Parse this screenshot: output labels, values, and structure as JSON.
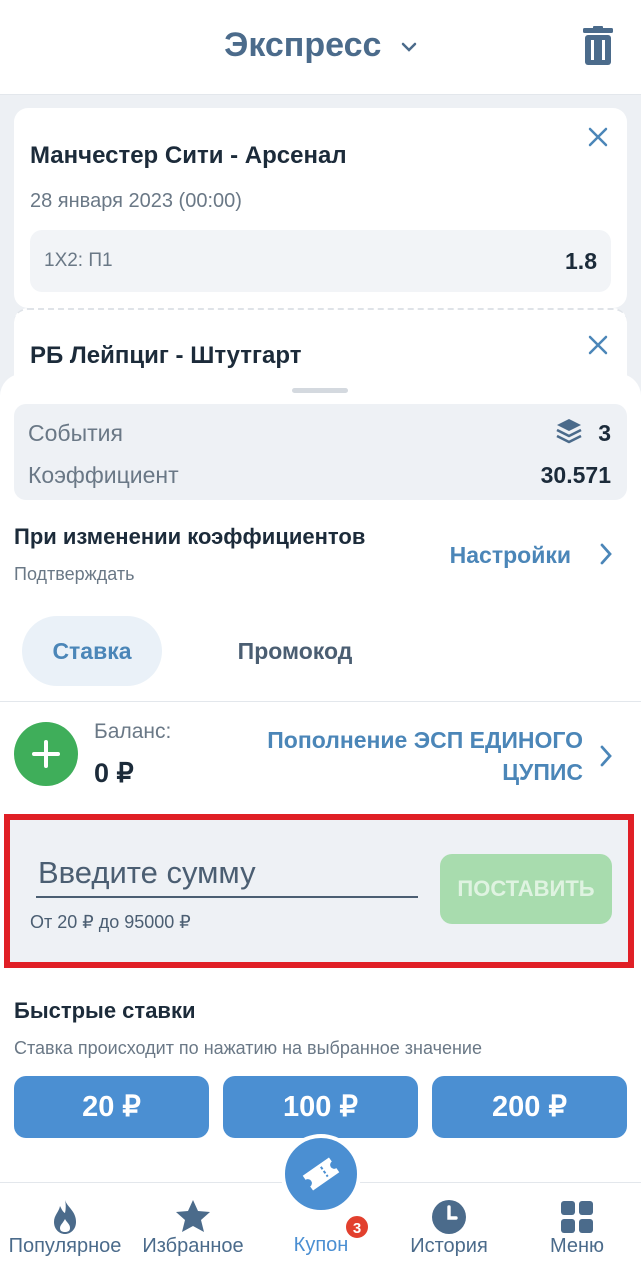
{
  "header": {
    "title": "Экспресс"
  },
  "events": [
    {
      "title": "Манчестер Сити - Арсенал",
      "date": "28 января 2023 (00:00)",
      "market": "1X2: П1",
      "coef": "1.8"
    },
    {
      "title": "РБ Лейпциг - Штутгарт"
    }
  ],
  "summary": {
    "events_label": "События",
    "events_count": "3",
    "coef_label": "Коэффициент",
    "coef_value": "30.571"
  },
  "settings": {
    "title": "При изменении коэффициентов",
    "subtitle": "Подтверждать",
    "link": "Настройки"
  },
  "tabs": [
    {
      "label": "Ставка",
      "active": true
    },
    {
      "label": "Промокод",
      "active": false
    }
  ],
  "balance": {
    "label": "Баланс:",
    "value": "0 ₽",
    "topup_link": "Пополнение ЭСП ЕДИНОГО ЦУПИС"
  },
  "amount": {
    "placeholder": "Введите сумму",
    "range": "От 20 ₽ до 95000 ₽",
    "submit_label": "ПОСТАВИТЬ"
  },
  "quick_bets": {
    "title": "Быстрые ставки",
    "subtitle": "Ставка происходит по нажатию на выбранное значение",
    "values": [
      "20 ₽",
      "100 ₽",
      "200 ₽"
    ]
  },
  "nav": {
    "items": [
      {
        "label": "Популярное",
        "icon": "flame-icon"
      },
      {
        "label": "Избранное",
        "icon": "star-icon"
      },
      {
        "label": "Купон",
        "icon": "ticket-icon",
        "badge": "3"
      },
      {
        "label": "История",
        "icon": "clock-icon"
      },
      {
        "label": "Меню",
        "icon": "grid-icon"
      }
    ]
  },
  "colors": {
    "accent": "#4b8fd2",
    "link": "#4b86b8",
    "success": "#3fae5a",
    "highlight_border": "#e01f26",
    "badge": "#e2402e"
  }
}
